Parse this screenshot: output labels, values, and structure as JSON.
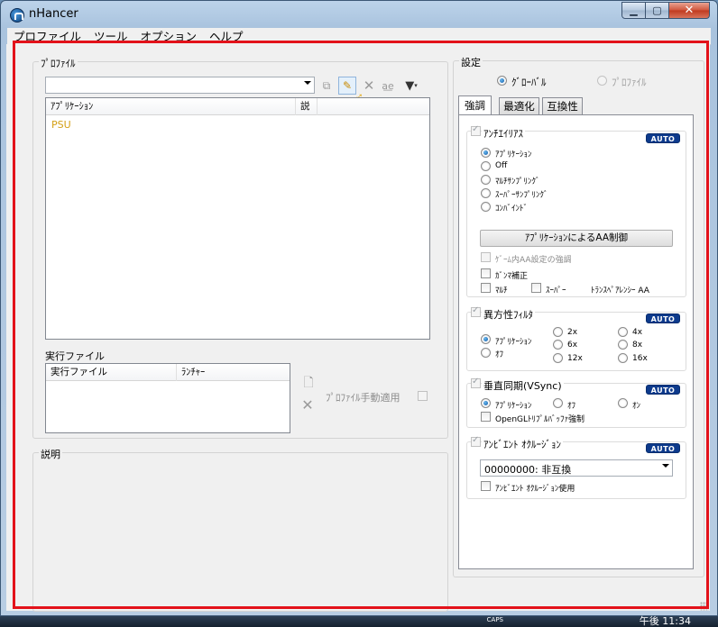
{
  "window": {
    "title": "nHancer"
  },
  "menu": [
    "プロファイル",
    "ツール",
    "オプション",
    "ヘルプ"
  ],
  "profile": {
    "group_title": "ﾌﾟﾛﾌｧｲﾙ",
    "combo_value": "",
    "columns": [
      "ｱﾌﾟﾘｹｰｼｮﾝ",
      "説"
    ],
    "apps": [
      {
        "name": "PSU",
        "color": "#d4a017"
      }
    ],
    "exe_section_title": "実行ファイル",
    "exe_columns": [
      "実行ファイル",
      "ﾗﾝﾁｬｰ"
    ],
    "manual_apply_label": "ﾌﾟﾛﾌｧｲﾙ手動適用"
  },
  "description": {
    "title": "説明"
  },
  "settings": {
    "title": "設定",
    "scope_global": "ｸﾞﾛｰﾊﾞﾙ",
    "scope_profile": "ﾌﾟﾛﾌｧｲﾙ",
    "tabs": [
      "強調",
      "最適化",
      "互換性"
    ],
    "auto_label": "AUTO",
    "aa": {
      "title": "ｱﾝﾁｴｲﾘｱｽ",
      "options": [
        "ｱﾌﾟﾘｹｰｼｮﾝ",
        "Off",
        "ﾏﾙﾁｻﾝﾌﾟﾘﾝｸﾞ",
        "ｽｰﾊﾟｰｻﾝﾌﾟﾘﾝｸﾞ",
        "ｺﾝﾊﾞｲﾝﾄﾞ"
      ],
      "button": "ｱﾌﾟﾘｹｰｼｮﾝによるAA制御",
      "ingame_label": "ｹﾞｰﾑ内AA設定の強調",
      "gamma_label": "ｶﾞﾝﾏ補正",
      "multi_label": "ﾏﾙﾁ",
      "super_label": "ｽｰﾊﾟｰ",
      "transparency_label": "ﾄﾗﾝｽﾍﾟｱﾚﾝｼｰ AA"
    },
    "af": {
      "title": "異方性ﾌｨﾙﾀ",
      "options": [
        "ｱﾌﾟﾘｹｰｼｮﾝ",
        "ｵﾌ",
        "2x",
        "6x",
        "12x",
        "4x",
        "8x",
        "16x"
      ]
    },
    "vsync": {
      "title": "垂直同期(VSync)",
      "options": [
        "ｱﾌﾟﾘｹｰｼｮﾝ",
        "ｵﾌ",
        "ｵﾝ"
      ],
      "opengl_label": "OpenGLﾄﾘﾌﾟﾙﾊﾞｯﾌｧ強制"
    },
    "ao": {
      "title": "ｱﾝﾋﾞｴﾝﾄ ｵｸﾙｰｼﾞｮﾝ",
      "combo_value": "00000000: 非互換",
      "use_label": "ｱﾝﾋﾞｴﾝﾄ ｵｸﾙｰｼﾞｮﾝ使用"
    }
  },
  "taskbar": {
    "caps": "CAPS",
    "clock": "午後 11:34"
  }
}
